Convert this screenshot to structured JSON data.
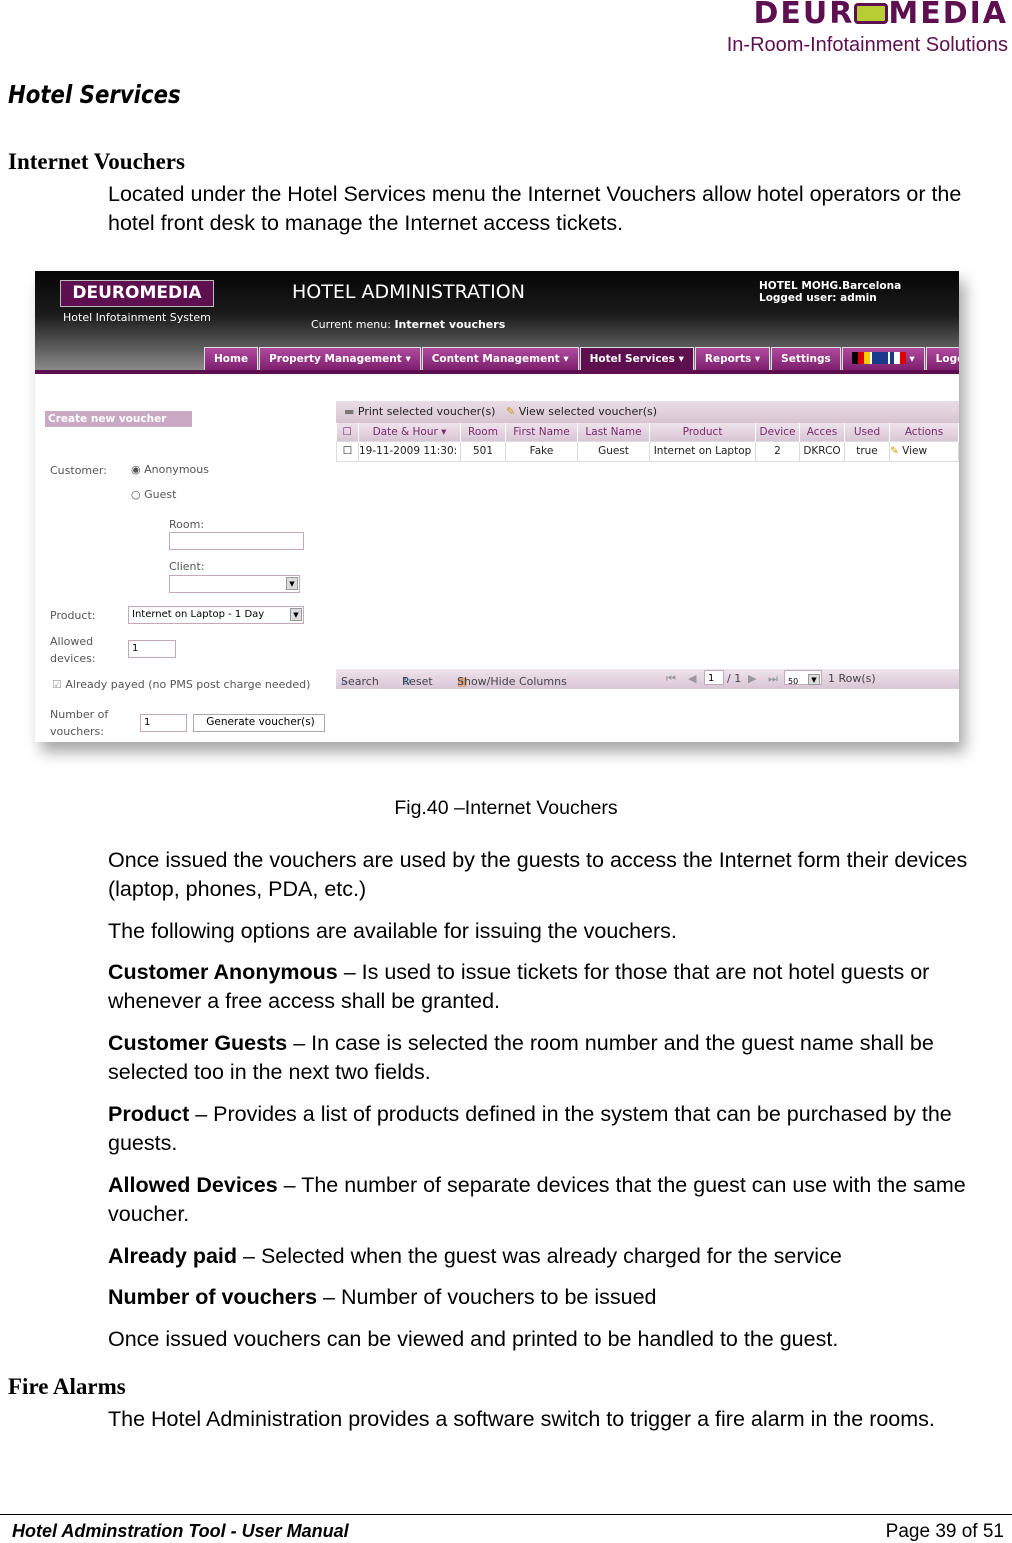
{
  "logo": {
    "brand": "DEUROMEDIA",
    "tagline": "In-Room-Infotainment Solutions"
  },
  "page_title": "Hotel Services",
  "section1": {
    "heading": "Internet Vouchers",
    "intro": "Located under the Hotel Services menu the Internet Vouchers allow hotel operators or the hotel front desk to manage the Internet access tickets."
  },
  "screenshot": {
    "logo": "DEUROMEDIA",
    "subtitle": "Hotel Infotainment System",
    "title": "HOTEL ADMINISTRATION",
    "current_menu_label": "Current menu:",
    "current_menu": "Internet vouchers",
    "hotel": "HOTEL MOHG.Barcelona",
    "logged_label": "Logged user:",
    "user": "admin",
    "nav": [
      "Home",
      "Property Management ▾",
      "Content Management ▾",
      "Hotel Services ▾",
      "Reports ▾",
      "Settings",
      "▾",
      "Logo"
    ],
    "form": {
      "header": "Create new voucher",
      "customer_label": "Customer:",
      "opt_anonymous": "Anonymous",
      "opt_guest": "Guest",
      "selected": "Anonymous",
      "room_label": "Room:",
      "room_value": "",
      "client_label": "Client:",
      "client_value": "",
      "product_label": "Product:",
      "product_value": "Internet on Laptop - 1 Day",
      "allowed_label1": "Allowed",
      "allowed_label2": "devices:",
      "allowed_value": "1",
      "paid_label": "Already payed (no PMS post charge needed)",
      "paid_checked": true,
      "num_label1": "Number of",
      "num_label2": "vouchers:",
      "num_value": "1",
      "generate": "Generate voucher(s)"
    },
    "grid": {
      "print": "Print selected voucher(s)",
      "view": "View selected voucher(s)",
      "columns": [
        "Date & Hour ▾",
        "Room",
        "First Name",
        "Last Name",
        "Product",
        "Device",
        "Acces",
        "Used",
        "Actions"
      ],
      "rows": [
        [
          "19-11-2009 11:30:",
          "501",
          "Fake",
          "Guest",
          "Internet on Laptop",
          "2",
          "DKRCO",
          "true",
          "View"
        ]
      ],
      "search": "Search",
      "reset": "Reset",
      "showhide": "Show/Hide Columns",
      "page": "1",
      "of": "/ 1",
      "per_page": "50",
      "rows_count": "1 Row(s)"
    }
  },
  "caption": "Fig.40 –Internet Vouchers",
  "paras": [
    {
      "b": "",
      "t": "Once issued the vouchers are used by the guests to access the Internet form their devices (laptop, phones, PDA, etc.)"
    },
    {
      "b": "",
      "t": "The following options are available for issuing the vouchers."
    },
    {
      "b": "Customer Anonymous",
      "t": " – Is used to issue tickets for those that are not hotel guests or whenever a free access shall be granted."
    },
    {
      "b": "Customer Guests",
      "t": " – In case is selected the room number and the guest name shall be selected too in the next two fields."
    },
    {
      "b": "Product",
      "t": " – Provides a list of products defined in the system that can be purchased by the guests."
    },
    {
      "b": "Allowed Devices",
      "t": " – The number of separate devices that the guest can use with the same voucher."
    },
    {
      "b": "Already paid",
      "t": " – Selected when the guest was already charged for the service"
    },
    {
      "b": "Number of vouchers",
      "t": " – Number of vouchers to be issued"
    },
    {
      "b": "",
      "t": "Once issued vouchers can be viewed and printed to be handled to the guest."
    }
  ],
  "section2": {
    "heading": "Fire Alarms",
    "text": "The Hotel Administration provides a software switch to trigger a fire alarm in the rooms."
  },
  "footer": {
    "title": "Hotel Adminstration Tool - User Manual",
    "page": "Page 39 of 51"
  }
}
